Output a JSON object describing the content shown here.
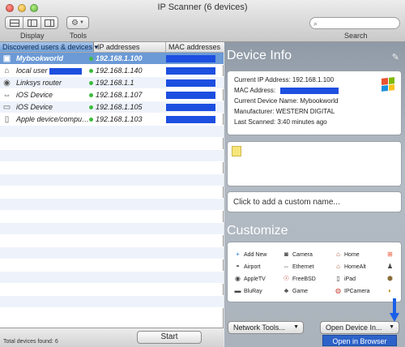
{
  "window": {
    "title": "IP Scanner (6 devices)"
  },
  "toolbar": {
    "display_label": "Display",
    "tools_label": "Tools",
    "search_label": "Search"
  },
  "table": {
    "headers": [
      "Discovered users & devices ▾",
      "IP addresses",
      "MAC addresses"
    ],
    "rows": [
      {
        "name": "Mybookworld",
        "ip": "192.168.1.100",
        "icon": "windows-computer-icon",
        "selected": true
      },
      {
        "name": "local user",
        "ip": "192.168.1.140",
        "icon": "home-icon",
        "selected": false
      },
      {
        "name": "Linksys router",
        "ip": "192.168.1.1",
        "icon": "router-icon",
        "selected": false
      },
      {
        "name": "iOS Device",
        "ip": "192.168.1.107",
        "icon": "ipod-icon",
        "selected": false
      },
      {
        "name": "iOS Device",
        "ip": "192.168.1.105",
        "icon": "ipod-icon",
        "selected": false
      },
      {
        "name": "Apple device/compu…",
        "ip": "192.168.1.103",
        "icon": "phone-icon",
        "selected": false
      }
    ]
  },
  "footer": {
    "total": "Total devices found: 6",
    "start_label": "Start"
  },
  "device_info": {
    "title": "Device Info",
    "current_ip": "Current IP Address:  192.168.1.100",
    "mac": "MAC Address:",
    "device_name": "Current Device Name:  Mybookworld",
    "manufacturer": "Manufacturer:  WESTERN DIGITAL",
    "last_scanned": "Last Scanned:  3:40 minutes ago"
  },
  "custom_name_placeholder": "Click to add a custom name...",
  "customize": {
    "title": "Customize",
    "items": [
      {
        "label": "Add New",
        "icon": "+"
      },
      {
        "label": "Camera",
        "icon": "◙"
      },
      {
        "label": "Home",
        "icon": "⌂"
      },
      {
        "label": "",
        "icon": "⊞"
      },
      {
        "label": "Airport",
        "icon": "◓"
      },
      {
        "label": "Ethernet",
        "icon": "⇔"
      },
      {
        "label": "HomeAlt",
        "icon": "⌂"
      },
      {
        "label": "",
        "icon": "♟"
      },
      {
        "label": "AppleTV",
        "icon": "◉"
      },
      {
        "label": "FreeBSD",
        "icon": "☉"
      },
      {
        "label": "iPad",
        "icon": "▯"
      },
      {
        "label": "",
        "icon": "⬢"
      },
      {
        "label": "BluRay",
        "icon": "▬"
      },
      {
        "label": "Game",
        "icon": "♣"
      },
      {
        "label": "IPCamera",
        "icon": "◍"
      },
      {
        "label": "",
        "icon": "◐"
      }
    ]
  },
  "buttons": {
    "network_tools": "Network Tools...",
    "open_device": "Open Device In...",
    "open_in_browser": "Open in Browser"
  },
  "colors": {
    "accent": "#6b9ad6",
    "redaction": "#1d4fe0",
    "status_online": "#3dbb3d"
  }
}
